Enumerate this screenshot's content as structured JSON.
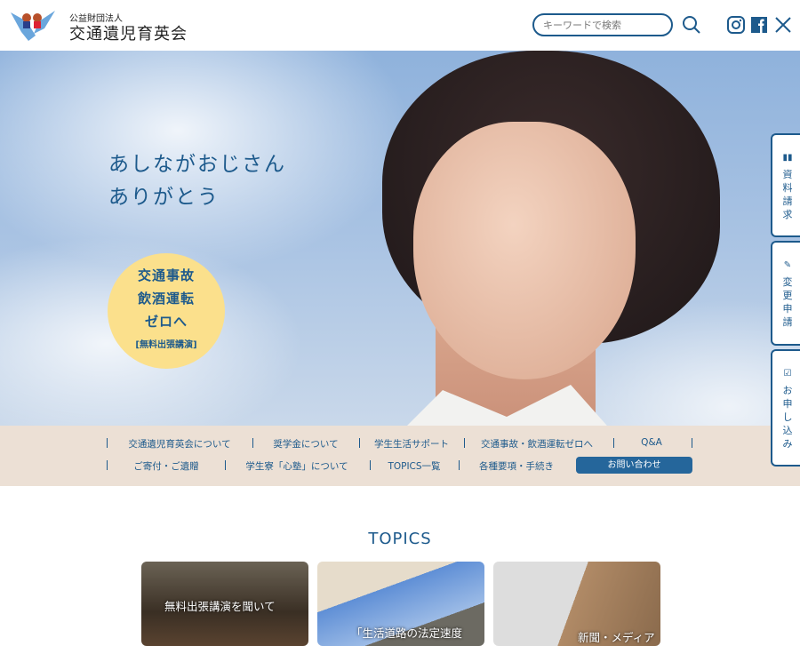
{
  "header": {
    "org_type": "公益財団法人",
    "org_name": "交通遺児育英会",
    "search_placeholder": "キーワードで検索"
  },
  "hero": {
    "catch_line1": "あしながおじさん",
    "catch_line2": "ありがとう",
    "badge_lines": [
      "交通事故",
      "飲酒運転",
      "ゼロへ"
    ],
    "badge_sub": "[無料出張講演]"
  },
  "nav": {
    "row1": [
      "交通遺児育英会について",
      "奨学金について",
      "学生生活サポート",
      "交通事故・飲酒運転ゼロへ",
      "Q&A"
    ],
    "row2": [
      "ご寄付・ご遺贈",
      "学生寮「心塾」について",
      "TOPICS一覧",
      "各種要項・手続き"
    ],
    "contact": "お問い合わせ"
  },
  "side_tabs": [
    {
      "label": "資料請求",
      "icon": "book-icon"
    },
    {
      "label": "変更申請",
      "icon": "pencil-icon"
    },
    {
      "label": "お申し込み",
      "icon": "form-edit-icon"
    }
  ],
  "topics": {
    "title": "TOPICS",
    "cards": [
      "無料出張講演を聞いて",
      "「生活道路の法定速度",
      "新聞・メディア"
    ]
  },
  "colors": {
    "brand": "#1d5a8c",
    "nav_bg": "#ece0d5",
    "badge": "#fbe08c"
  }
}
